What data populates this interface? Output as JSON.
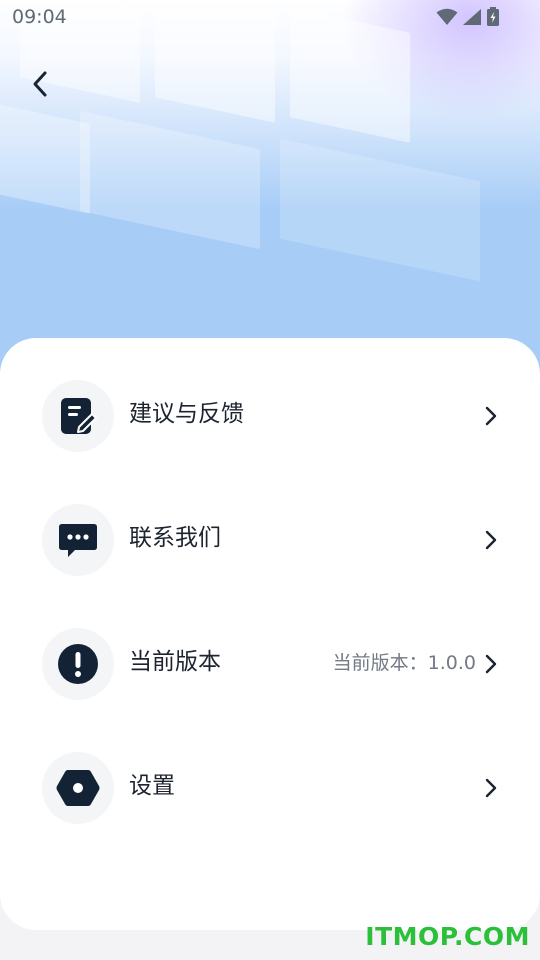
{
  "status_bar": {
    "time": "09:04"
  },
  "colors": {
    "icon_dark": "#142236",
    "hero_blue": "#a7cdf7",
    "watermark_green": "#2bbf3a"
  },
  "menu": [
    {
      "label": "建议与反馈",
      "icon": "edit-note-icon",
      "value": ""
    },
    {
      "label": "联系我们",
      "icon": "chat-bubble-icon",
      "value": ""
    },
    {
      "label": "当前版本",
      "icon": "info-exclamation-icon",
      "value": "当前版本：1.0.0"
    },
    {
      "label": "设置",
      "icon": "hexagon-settings-icon",
      "value": ""
    }
  ],
  "watermark": "ITMOP.COM"
}
